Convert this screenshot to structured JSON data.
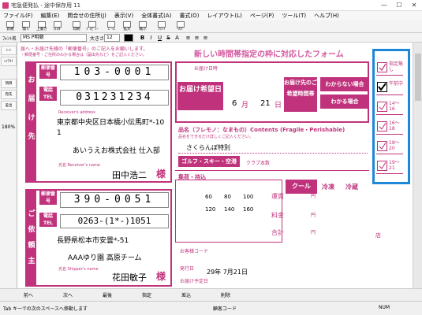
{
  "window": {
    "title": "宅急便発払 - 途中保存用 11",
    "min": "—",
    "max": "☐",
    "close": "✕"
  },
  "menu": [
    "ファイル(F)",
    "編集(E)",
    "問合せの住所(J)",
    "表示(V)",
    "全体書式(A)",
    "書式(O)",
    "レイアウト(L)",
    "ページ(P)",
    "ツール(T)",
    "ヘルプ(H)"
  ],
  "toolbar": [
    "新規",
    "開く",
    "上書き",
    "ﾌｫﾙﾀﾞ",
    "印刷",
    "ﾌﾟﾚﾋﾞｭｰ",
    "ｽﾞｰﾑ",
    "拡大",
    "縮小",
    "ﾌｫﾝﾄ",
    "ﾍﾙﾌﾟ"
  ],
  "format": {
    "font_label": "ﾌｫﾝﾄ名",
    "font": "MS P明朝",
    "size_label": "大きさ",
    "size": "12",
    "bold": "B",
    "italic": "I",
    "underline": "U",
    "strike": "S",
    "shadow": "A"
  },
  "left_panel": [
    "ｼｰﾄ",
    "ﾚｲｱｳﾄ",
    "",
    "項目",
    "宛先",
    "差出",
    "180%"
  ],
  "form": {
    "notice1": "届へ・お届け先様の「郵便番号」のご記入をお願いします。",
    "notice2": "・郵便番号・ご住所のわかる場合は（届出先など）をご記入ください。",
    "headline": "新しい時間帯指定の枠に対応したフォーム",
    "to_vert": [
      "お",
      "届",
      "け",
      "先"
    ],
    "from_vert": [
      "ご",
      "依",
      "頼",
      "主"
    ],
    "postal_tag": "郵便番号",
    "tel_tag": "電話TEL",
    "to_postal": "103-0001",
    "to_tel": "031231234",
    "to_addr_label": "Receiver's address",
    "to_addr": "東京都中央区日本橋小伝馬町*-10",
    "to_addr2": "1",
    "to_company": "あいうえお株式会社 仕入部",
    "to_name_label": "氏名 Receiver's name",
    "to_name": "田中浩二",
    "sama": "様",
    "from_postal": "390-0051",
    "from_tel": "0263-(1*-)1051",
    "from_addr": "長野県松本市安曇*-51",
    "from_company": "AAAゆり園 高原チーム",
    "from_name_label": "氏名 Shipper's name",
    "from_name": "花田敏子",
    "pickup_label": "お届け日時",
    "deliv_date_tag": "お届け希望日",
    "month": "6",
    "month_unit": "月",
    "day": "21",
    "day_unit": "日",
    "time_tag": "お届け先のご希望時間帯",
    "unknown1": "わからない場合",
    "unknown2": "わかる場合",
    "item_label": "品名（フレモノ：なまもの）Contents (Fragile・Perishable)",
    "item_note": "品名をできるだけ詳しくご記入ください。",
    "item_value": "さくらんぼ特別",
    "golf": "ゴルフ・スキー・空港",
    "club": "クラブ本数",
    "service_row": "集荷・持込",
    "services": [
      "クール",
      "冷凍",
      "冷蔵"
    ],
    "sizes": [
      "60",
      "80",
      "100",
      "120",
      "140",
      "160"
    ],
    "charge_rows": [
      "運賃",
      "料金",
      "合計"
    ],
    "yen": "円",
    "item_code_label": "お客様コード",
    "ship_date_label": "発行日",
    "ship_date": "29年 7月21日",
    "deliver_due": "お届け予定日",
    "shop": "店",
    "timeslots": [
      {
        "label": "指定無し",
        "checked": false
      },
      {
        "label": "午前中",
        "checked": true
      },
      {
        "label": "14〜16",
        "checked": false
      },
      {
        "label": "16〜18",
        "checked": false
      },
      {
        "label": "18〜20",
        "checked": false
      },
      {
        "label": "19〜21",
        "checked": false
      }
    ]
  },
  "nav": [
    "前へ",
    "次へ",
    "最後",
    "指定",
    "差込",
    "削除"
  ],
  "status": {
    "left": "Tab キーでの次のスペースへ移動します",
    "mid": "顧客コード",
    "num": "NUM"
  },
  "colors": {
    "accent": "#c0337c",
    "highlight": "#1e88d8"
  }
}
